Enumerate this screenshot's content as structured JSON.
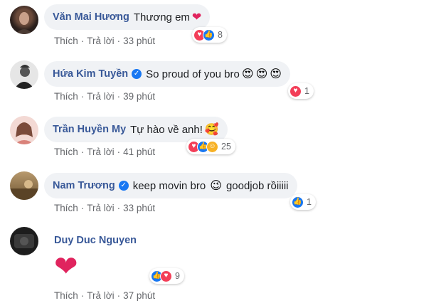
{
  "comments": [
    {
      "author": "Văn Mai Hương",
      "verified": false,
      "text": "Thương em",
      "emojis": [
        "❤"
      ],
      "actions": {
        "like": "Thích",
        "reply": "Trả lời",
        "time": "33 phút"
      },
      "reactions": {
        "icons": [
          "love-icon",
          "like-icon"
        ],
        "count": "8"
      }
    },
    {
      "author": "Hứa Kim Tuyền",
      "verified": true,
      "text": "So proud of you bro",
      "emojis": [
        "😍",
        "😍",
        "😍"
      ],
      "actions": {
        "like": "Thích",
        "reply": "Trả lời",
        "time": "39 phút"
      },
      "reactions": {
        "icons": [
          "love-icon"
        ],
        "count": "1"
      }
    },
    {
      "author": "Trần Huyền My",
      "verified": false,
      "text": "Tự hào về anh!",
      "emojis": [
        "🥰"
      ],
      "actions": {
        "like": "Thích",
        "reply": "Trả lời",
        "time": "41 phút"
      },
      "reactions": {
        "icons": [
          "love-icon",
          "like-icon",
          "care-icon"
        ],
        "count": "25"
      }
    },
    {
      "author": "Nam Trương",
      "verified": true,
      "text": "keep movin bro",
      "emojis": [
        "😉"
      ],
      "text2": "goodjob rồiiiii",
      "actions": {
        "like": "Thích",
        "reply": "Trả lời",
        "time": "33 phút"
      },
      "reactions": {
        "icons": [
          "like-icon"
        ],
        "count": "1"
      }
    },
    {
      "author": "Duy Duc Nguyen",
      "verified": false,
      "sticker": "❤",
      "actions": {
        "like": "Thích",
        "reply": "Trả lời",
        "time": "37 phút"
      },
      "reactions": {
        "icons": [
          "like-icon",
          "love-icon"
        ],
        "count": "9"
      }
    }
  ],
  "colors": {
    "author": "#385898",
    "bubble": "#f0f2f5",
    "meta": "#65676b",
    "love": "#f33e58",
    "like": "#1877f2",
    "care": "#f7b125"
  }
}
